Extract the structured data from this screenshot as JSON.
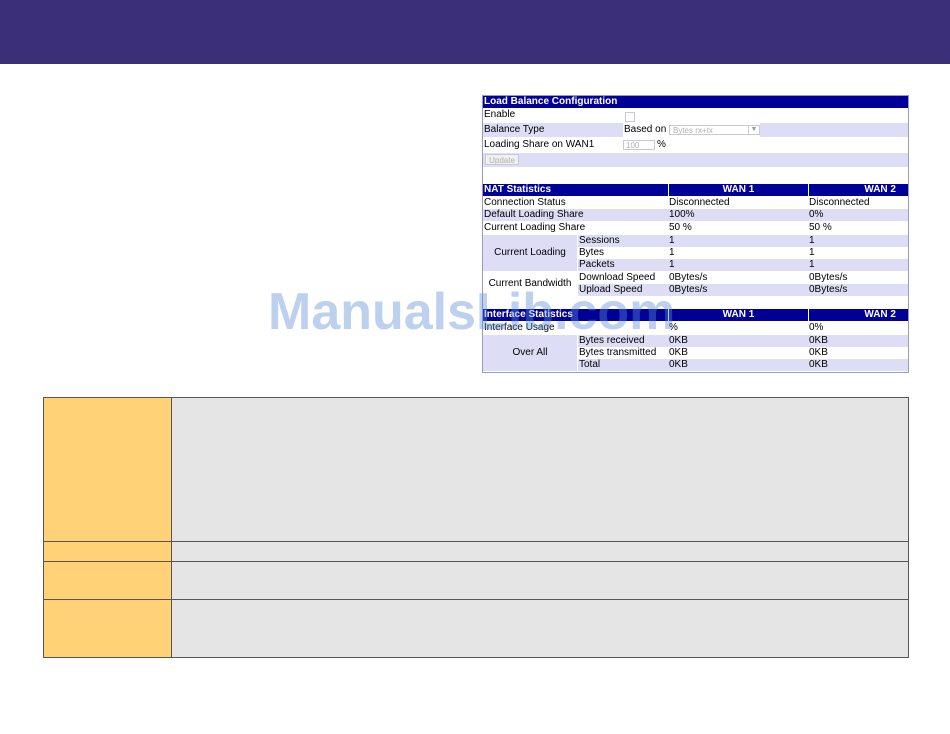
{
  "watermark": "ManualsLib.com",
  "load_balance": {
    "title": "Load Balance Configuration",
    "enable_label": "Enable",
    "balance_type_label": "Balance Type",
    "based_on_label": "Based on",
    "based_on_value": "Bytes rx+tx",
    "loading_share_label": "Loading Share on WAN1",
    "loading_share_value": "100",
    "percent": "%",
    "update_button": "Update"
  },
  "nat": {
    "title": "NAT Statistics",
    "wan1": "WAN 1",
    "wan2": "WAN 2",
    "connection_status": {
      "label": "Connection Status",
      "wan1": "Disconnected",
      "wan2": "Disconnected"
    },
    "default_share": {
      "label": "Default Loading Share",
      "wan1": "100%",
      "wan2": "0%"
    },
    "current_share": {
      "label": "Current Loading Share",
      "wan1": "50 %",
      "wan2": "50 %"
    },
    "current_loading": {
      "label": "Current Loading",
      "rows": [
        {
          "label": "Sessions",
          "wan1": "1",
          "wan2": "1"
        },
        {
          "label": "Bytes",
          "wan1": "1",
          "wan2": "1"
        },
        {
          "label": "Packets",
          "wan1": "1",
          "wan2": "1"
        }
      ]
    },
    "current_bandwidth": {
      "label": "Current Bandwidth",
      "rows": [
        {
          "label": "Download Speed",
          "wan1": "0Bytes/s",
          "wan2": "0Bytes/s"
        },
        {
          "label": "Upload Speed",
          "wan1": "0Bytes/s",
          "wan2": "0Bytes/s"
        }
      ]
    }
  },
  "interface": {
    "title": "Interface Statistics",
    "wan1": "WAN 1",
    "wan2": "WAN 2",
    "usage": {
      "label": "Interface Usage",
      "wan1": "%",
      "wan2": "0%"
    },
    "overall": {
      "label": "Over All",
      "rows": [
        {
          "label": "Bytes received",
          "wan1": "0KB",
          "wan2": "0KB"
        },
        {
          "label": "Bytes transmitted",
          "wan1": "0KB",
          "wan2": "0KB"
        },
        {
          "label": "Total",
          "wan1": "0KB",
          "wan2": "0KB"
        }
      ]
    }
  }
}
